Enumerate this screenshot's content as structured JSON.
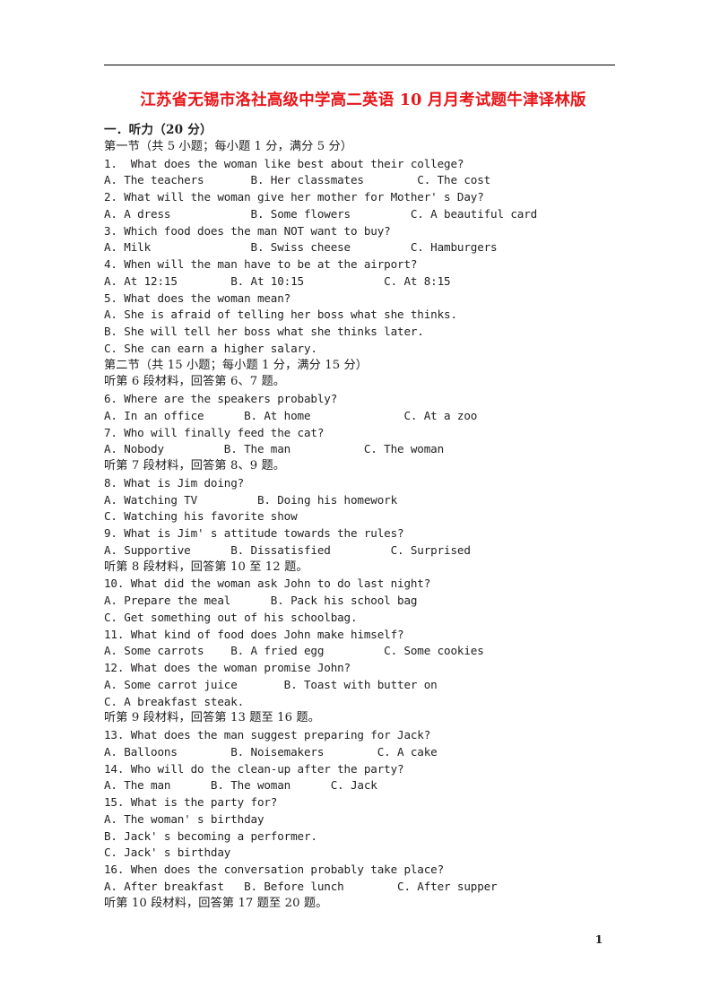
{
  "document": {
    "title": "江苏省无锡市洛社高级中学高二英语 10 月月考试题牛津译林版",
    "title_color": "#e8161a",
    "page_number": "1"
  },
  "sections": [
    {
      "heading": "一．听力（20 分）",
      "subheading": "第一节（共 5 小题；每小题 1 分，满分 5 分）"
    }
  ],
  "lines": [
    {
      "id": "l01",
      "kind": "heading",
      "text": "一．听力（20 分）"
    },
    {
      "id": "l02",
      "kind": "cn",
      "text": "第一节（共 5 小题；每小题 1 分，满分 5 分）"
    },
    {
      "id": "l03",
      "kind": "en",
      "text": "1.  What does the woman like best about their college?"
    },
    {
      "id": "l04",
      "kind": "en",
      "text": "A. The teachers       B. Her classmates        C. The cost"
    },
    {
      "id": "l05",
      "kind": "en",
      "text": "2. What will the woman give her mother for Mother' s Day?"
    },
    {
      "id": "l06",
      "kind": "en",
      "text": "A. A dress            B. Some flowers         C. A beautiful card"
    },
    {
      "id": "l07",
      "kind": "en",
      "text": "3. Which food does the man NOT want to buy?"
    },
    {
      "id": "l08",
      "kind": "en",
      "text": "A. Milk               B. Swiss cheese         C. Hamburgers"
    },
    {
      "id": "l09",
      "kind": "en",
      "text": "4. When will the man have to be at the airport?"
    },
    {
      "id": "l10",
      "kind": "en",
      "text": "A. At 12:15        B. At 10:15            C. At 8:15"
    },
    {
      "id": "l11",
      "kind": "en",
      "text": "5. What does the woman mean?"
    },
    {
      "id": "l12",
      "kind": "en",
      "text": "A. She is afraid of telling her boss what she thinks."
    },
    {
      "id": "l13",
      "kind": "en",
      "text": "B. She will tell her boss what she thinks later."
    },
    {
      "id": "l14",
      "kind": "en",
      "text": "C. She can earn a higher salary."
    },
    {
      "id": "l15",
      "kind": "cn",
      "text": "第二节（共 15 小题；每小题 1 分，满分 15 分）"
    },
    {
      "id": "l16",
      "kind": "cn",
      "text": "听第 6 段材料，回答第 6、7 题。"
    },
    {
      "id": "l17",
      "kind": "en",
      "text": "6. Where are the speakers probably?"
    },
    {
      "id": "l18",
      "kind": "en",
      "text": "A. In an office      B. At home              C. At a zoo"
    },
    {
      "id": "l19",
      "kind": "en",
      "text": "7. Who will finally feed the cat?"
    },
    {
      "id": "l20",
      "kind": "en",
      "text": "A. Nobody         B. The man           C. The woman"
    },
    {
      "id": "l21",
      "kind": "cn",
      "text": "听第 7 段材料，回答第 8、9 题。"
    },
    {
      "id": "l22",
      "kind": "en",
      "text": "8. What is Jim doing?"
    },
    {
      "id": "l23",
      "kind": "en",
      "text": "A. Watching TV         B. Doing his homework"
    },
    {
      "id": "l24",
      "kind": "en",
      "text": "C. Watching his favorite show"
    },
    {
      "id": "l25",
      "kind": "en",
      "text": "9. What is Jim' s attitude towards the rules?"
    },
    {
      "id": "l26",
      "kind": "en",
      "text": "A. Supportive      B. Dissatisfied         C. Surprised"
    },
    {
      "id": "l27",
      "kind": "cn",
      "text": "听第 8 段材料，回答第 10 至 12 题。"
    },
    {
      "id": "l28",
      "kind": "en",
      "text": "10. What did the woman ask John to do last night?"
    },
    {
      "id": "l29",
      "kind": "en",
      "text": "A. Prepare the meal      B. Pack his school bag"
    },
    {
      "id": "l30",
      "kind": "en",
      "text": "C. Get something out of his schoolbag."
    },
    {
      "id": "l31",
      "kind": "en",
      "text": "11. What kind of food does John make himself?"
    },
    {
      "id": "l32",
      "kind": "en",
      "text": "A. Some carrots    B. A fried egg         C. Some cookies"
    },
    {
      "id": "l33",
      "kind": "en",
      "text": "12. What does the woman promise John?"
    },
    {
      "id": "l34",
      "kind": "en",
      "text": "A. Some carrot juice       B. Toast with butter on"
    },
    {
      "id": "l35",
      "kind": "en",
      "text": "C. A breakfast steak."
    },
    {
      "id": "l36",
      "kind": "cn",
      "text": "听第 9 段材料，回答第 13 题至 16 题。"
    },
    {
      "id": "l37",
      "kind": "en",
      "text": "13. What does the man suggest preparing for Jack?"
    },
    {
      "id": "l38",
      "kind": "en",
      "text": "A. Balloons        B. Noisemakers        C. A cake"
    },
    {
      "id": "l39",
      "kind": "en",
      "text": "14. Who will do the clean-up after the party?"
    },
    {
      "id": "l40",
      "kind": "en",
      "text": "A. The man      B. The woman      C. Jack"
    },
    {
      "id": "l41",
      "kind": "en",
      "text": "15. What is the party for?"
    },
    {
      "id": "l42",
      "kind": "en",
      "text": "A. The woman' s birthday"
    },
    {
      "id": "l43",
      "kind": "en",
      "text": "B. Jack' s becoming a performer."
    },
    {
      "id": "l44",
      "kind": "en",
      "text": "C. Jack' s birthday"
    },
    {
      "id": "l45",
      "kind": "en",
      "text": "16. When does the conversation probably take place?"
    },
    {
      "id": "l46",
      "kind": "en",
      "text": "A. After breakfast   B. Before lunch        C. After supper"
    },
    {
      "id": "l47",
      "kind": "cn",
      "text": "听第 10 段材料，回答第 17 题至 20 题。"
    }
  ]
}
